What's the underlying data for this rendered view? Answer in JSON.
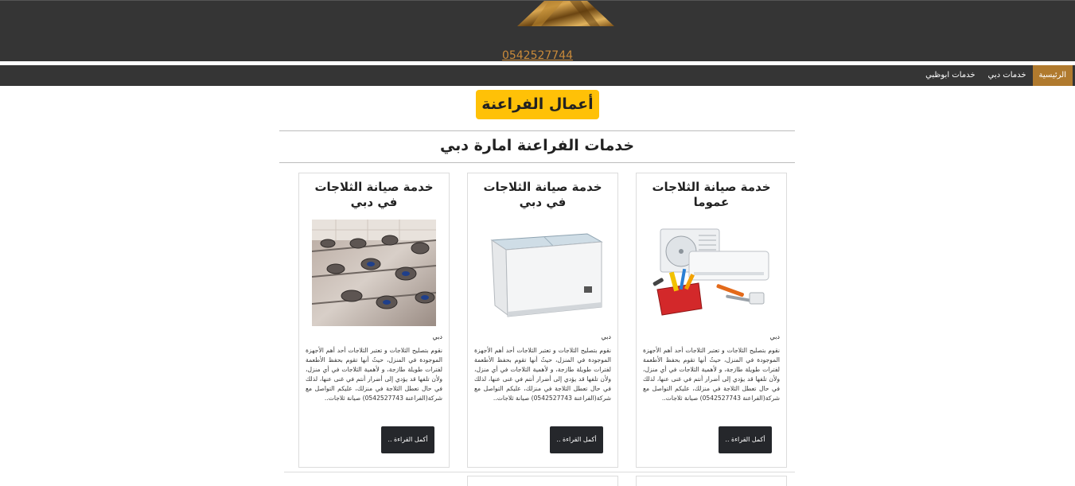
{
  "header": {
    "logo_icon": "pharaoh-logo",
    "phone": "0542527744"
  },
  "nav": {
    "items": [
      {
        "label": "الرئيسية",
        "active": true
      },
      {
        "label": "خدمات دبي",
        "active": false
      },
      {
        "label": "خدمات ابوظبي",
        "active": false
      }
    ]
  },
  "brand": {
    "label": "أعمال الفراعنة",
    "color": "#ffc107"
  },
  "section": {
    "title": "خدمات الفراعنة امارة دبي"
  },
  "cards": [
    {
      "title": "خدمة صيانة الثلاجات عموما",
      "image_icon": "ac-unit-tools-image",
      "tag": "دبي",
      "text": "نقوم بتصليح الثلاجات و تعتبر الثلاجات أحد أهم الأجهزة الموجودة في المنزل، حيثُ أنها تقوم بحفظ الأطعمة لفترات طويلة طازجة، و لأهمية الثلاجات في أي منزل، ولأن تلفها قد يؤدي إلى أضرار أنتم في غنى عنها، لذلك في حال تعطل الثلاجة في منزلك، عليكم التواصل مع شركة(الفراعنة 0542527743) صيانة ثلاجات..",
      "button": "أكمل القراءة .."
    },
    {
      "title": "خدمة صيانة الثلاجات في دبي",
      "image_icon": "chest-freezer-image",
      "tag": "دبي",
      "text": "نقوم بتصليح الثلاجات و تعتبر الثلاجات أحد أهم الأجهزة الموجودة في المنزل، حيثُ أنها تقوم بحفظ الأطعمة لفترات طويلة طازجة، و لأهمية الثلاجات في أي منزل، ولأن تلفها قد يؤدي إلى أضرار أنتم في غنى عنها، لذلك في حال تعطل الثلاجة في منزلك، عليكم التواصل مع شركة(الفراعنة 0542527743) صيانة ثلاجات..",
      "button": "أكمل القراءة .."
    },
    {
      "title": "خدمة صيانة الثلاجات في دبي",
      "image_icon": "gas-stove-image",
      "tag": "دبي",
      "text": "نقوم بتصليح الثلاجات و تعتبر الثلاجات أحد أهم الأجهزة الموجودة في المنزل، حيثُ أنها تقوم بحفظ الأطعمة لفترات طويلة طازجة، و لأهمية الثلاجات في أي منزل، ولأن تلفها قد يؤدي إلى أضرار أنتم في غنى عنها، لذلك في حال تعطل الثلاجة في منزلك، عليكم التواصل مع شركة(الفراعنة 0542527743) صيانة ثلاجات..",
      "button": "أكمل القراءة .."
    }
  ]
}
